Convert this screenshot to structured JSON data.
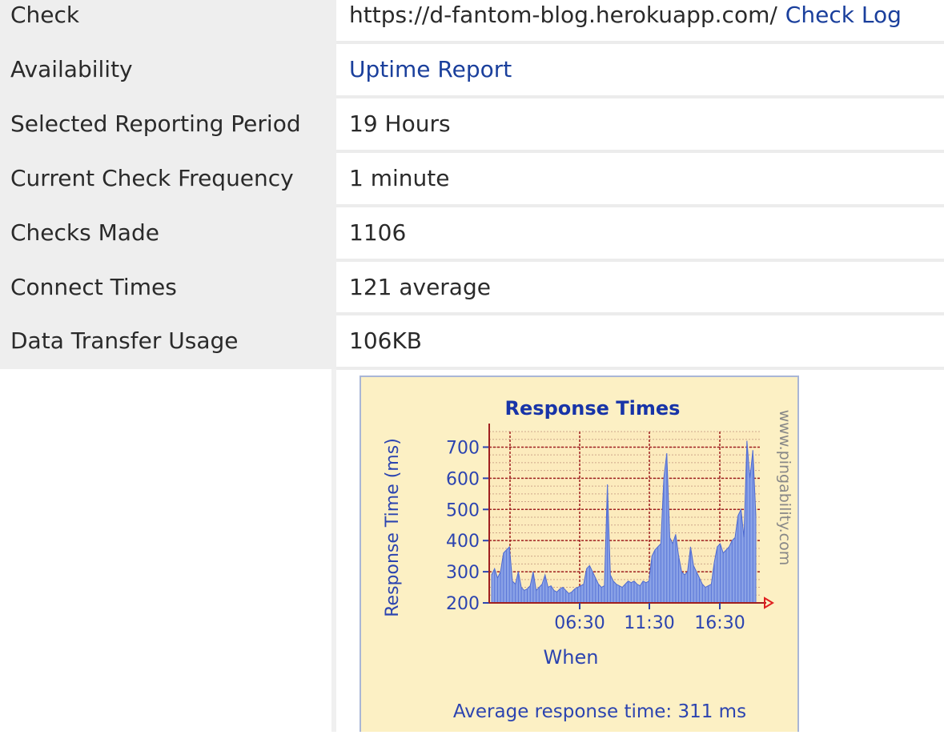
{
  "rows": [
    {
      "label": "Check",
      "value": "https://d-fantom-blog.herokuapp.com/",
      "link": "Check Log"
    },
    {
      "label": "Availability",
      "link": "Uptime Report"
    },
    {
      "label": "Selected Reporting Period",
      "value": "19 Hours"
    },
    {
      "label": "Current Check Frequency",
      "value": "1 minute"
    },
    {
      "label": "Checks Made",
      "value": "1106"
    },
    {
      "label": "Connect Times",
      "value": "121 average"
    },
    {
      "label": "Data Transfer Usage",
      "value": "106KB"
    }
  ],
  "chart": {
    "title": "Response Times",
    "ylabel": "Response Time (ms)",
    "xlabel": "When",
    "watermark": "www.pingability.com",
    "footer": "Average response time: 311 ms",
    "x_tick_labels": [
      "06:30",
      "11:30",
      "16:30"
    ],
    "y_tick_labels": [
      "200",
      "300",
      "400",
      "500",
      "600",
      "700"
    ]
  },
  "chart_data": {
    "type": "area",
    "title": "Response Times",
    "xlabel": "When",
    "ylabel": "Response Time (ms)",
    "ylim": [
      200,
      750
    ],
    "y_ticks": [
      200,
      300,
      400,
      500,
      600,
      700
    ],
    "x_ticks": [
      "06:30",
      "11:30",
      "16:30"
    ],
    "grid": true,
    "series": [
      {
        "values": [
          290,
          310,
          280,
          300,
          360,
          370,
          380,
          270,
          260,
          300,
          250,
          240,
          245,
          255,
          300,
          240,
          250,
          260,
          290,
          250,
          255,
          240,
          235,
          245,
          250,
          240,
          230,
          235,
          245,
          250,
          255,
          260,
          310,
          320,
          300,
          280,
          260,
          250,
          255,
          580,
          290,
          270,
          260,
          255,
          250,
          260,
          270,
          265,
          270,
          260,
          255,
          270,
          265,
          270,
          350,
          370,
          380,
          390,
          600,
          680,
          410,
          390,
          420,
          350,
          300,
          290,
          300,
          380,
          320,
          300,
          280,
          260,
          250,
          255,
          260,
          330,
          380,
          390,
          360,
          370,
          380,
          400,
          410,
          480,
          500,
          410,
          720,
          600,
          690,
          480
        ]
      }
    ],
    "average_ms": 311
  }
}
